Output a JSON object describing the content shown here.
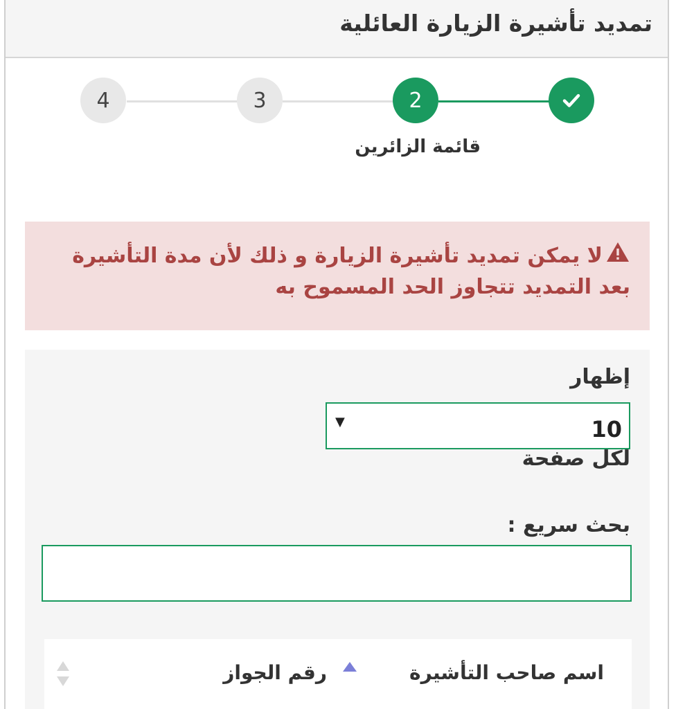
{
  "header": {
    "title": "تمديد تأشيرة الزيارة العائلية"
  },
  "stepper": {
    "steps": [
      {
        "label": "✔",
        "state": "done"
      },
      {
        "label": "2",
        "state": "active"
      },
      {
        "label": "3",
        "state": "pending"
      },
      {
        "label": "4",
        "state": "pending"
      }
    ],
    "active_label": "قائمة الزائرين"
  },
  "alert": {
    "icon": "warning-icon",
    "message": "لا يمكن تمديد تأشيرة الزيارة و ذلك لأن مدة التأشيرة بعد التمديد تتجاوز الحد المسموح به"
  },
  "filters": {
    "show_label": "إظهار",
    "page_size_value": "10",
    "per_page_label": "لكل صفحة",
    "search_label": "بحث سريع :",
    "search_value": ""
  },
  "table": {
    "columns": [
      {
        "label": "اسم صاحب التأشيرة",
        "sort": "asc"
      },
      {
        "label": "رقم الجواز",
        "sort": "none"
      }
    ]
  },
  "colors": {
    "primary": "#1a9a5f",
    "alert_bg": "#f3dede",
    "alert_text": "#a94442",
    "pending_step": "#e8e8e8"
  }
}
